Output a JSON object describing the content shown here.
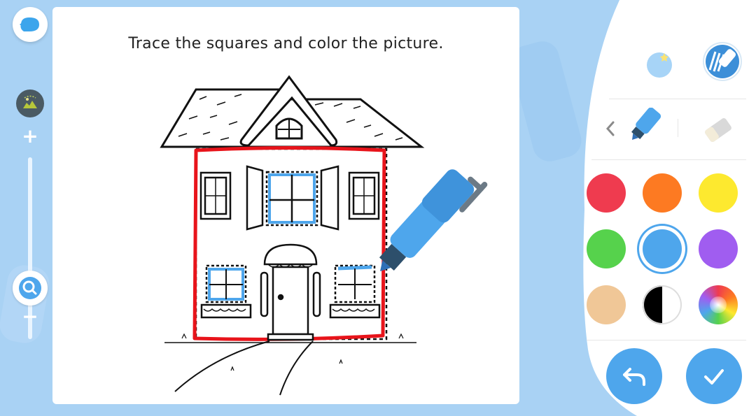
{
  "instruction": "Trace the squares and color the picture.",
  "toolbar": {
    "back_icon": "back-bubble-icon",
    "zoom_thumbnail_icon": "thumbnail-icon",
    "zoom_in_label": "+",
    "zoom_out_label": "−",
    "zoom_level": 0.0
  },
  "tools": {
    "sticker_icon": "sticker-bubble-icon",
    "pattern_brush_icon": "pattern-brush-icon",
    "prev_icon": "chevron-left-icon",
    "marker_icon": "marker-icon",
    "eraser_icon": "eraser-icon",
    "active_tool": "marker"
  },
  "palette": {
    "selected": "blue",
    "colors": [
      {
        "name": "red",
        "hex": "#ef3b4f"
      },
      {
        "name": "orange",
        "hex": "#fd7a22"
      },
      {
        "name": "yellow",
        "hex": "#fde92f"
      },
      {
        "name": "green",
        "hex": "#56d24c"
      },
      {
        "name": "blue",
        "hex": "#4ea6ec"
      },
      {
        "name": "purple",
        "hex": "#a05df0"
      },
      {
        "name": "skin",
        "hex": "#f0c797"
      },
      {
        "name": "black-white",
        "hex": "#000000"
      },
      {
        "name": "rainbow",
        "hex": "multicolor"
      }
    ]
  },
  "actions": {
    "undo_icon": "undo-icon",
    "confirm_icon": "checkmark-icon"
  },
  "colors": {
    "background": "#a9d2f4",
    "accent": "#4ea6ec",
    "trace_red": "#e8141b"
  }
}
